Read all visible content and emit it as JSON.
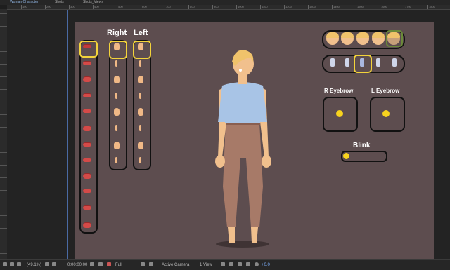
{
  "tabs": [
    {
      "label": "Woman Character"
    },
    {
      "label": "Shots"
    },
    {
      "label": "Shots_Views"
    }
  ],
  "ruler_numbers": [
    "100",
    "200",
    "300",
    "400",
    "500",
    "600",
    "700",
    "800",
    "900",
    "1000",
    "1100",
    "1200",
    "1300",
    "1400",
    "1500",
    "1600",
    "1700",
    "1800"
  ],
  "composition": {
    "labels": {
      "right": "Right",
      "left": "Left",
      "r_eyebrow": "R Eyebrow",
      "l_eyebrow": "L Eyebrow",
      "blink": "Blink"
    },
    "colors": {
      "background": "#5d4d4f",
      "selection": "#f3d33b",
      "control_dot": "#f7d31e"
    }
  },
  "viewer_bar": {
    "zoom": "(49.1%)",
    "timecode": "0;00;00;00",
    "resolution": "Full",
    "camera": "Active Camera",
    "views": "1 View",
    "exposure": "+0.0"
  }
}
